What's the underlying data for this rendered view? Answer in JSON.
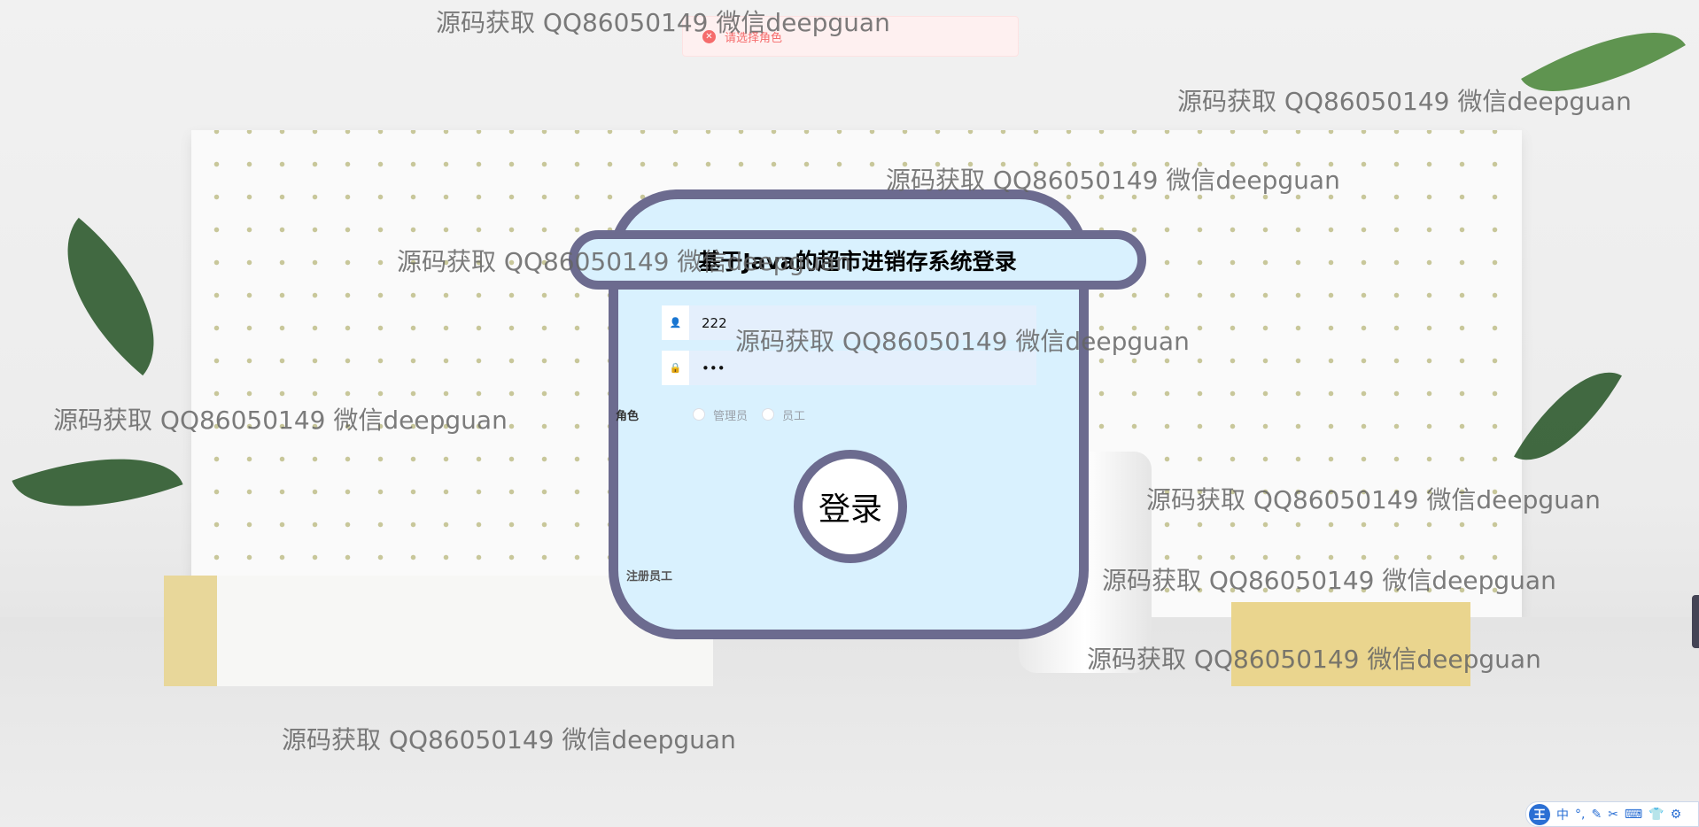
{
  "toast": {
    "message": "请选择角色",
    "icon": "error-circle-icon",
    "color": "#f56c6c"
  },
  "title": "基于Java的超市进销存系统登录",
  "form": {
    "username_value": "222",
    "password_value": "•••",
    "role_label": "角色",
    "roles": [
      "管理员",
      "员工"
    ],
    "login_label": "登录",
    "register_link": "注册员工"
  },
  "watermark": "源码获取 QQ86050149 微信deepguan",
  "ime": {
    "logo": "王",
    "items": [
      "中",
      "°,",
      "✎",
      "✂",
      "⌨",
      "👕",
      "⚙"
    ]
  },
  "colors": {
    "card_bg": "#d9f1fe",
    "border": "#6c6b8f"
  }
}
